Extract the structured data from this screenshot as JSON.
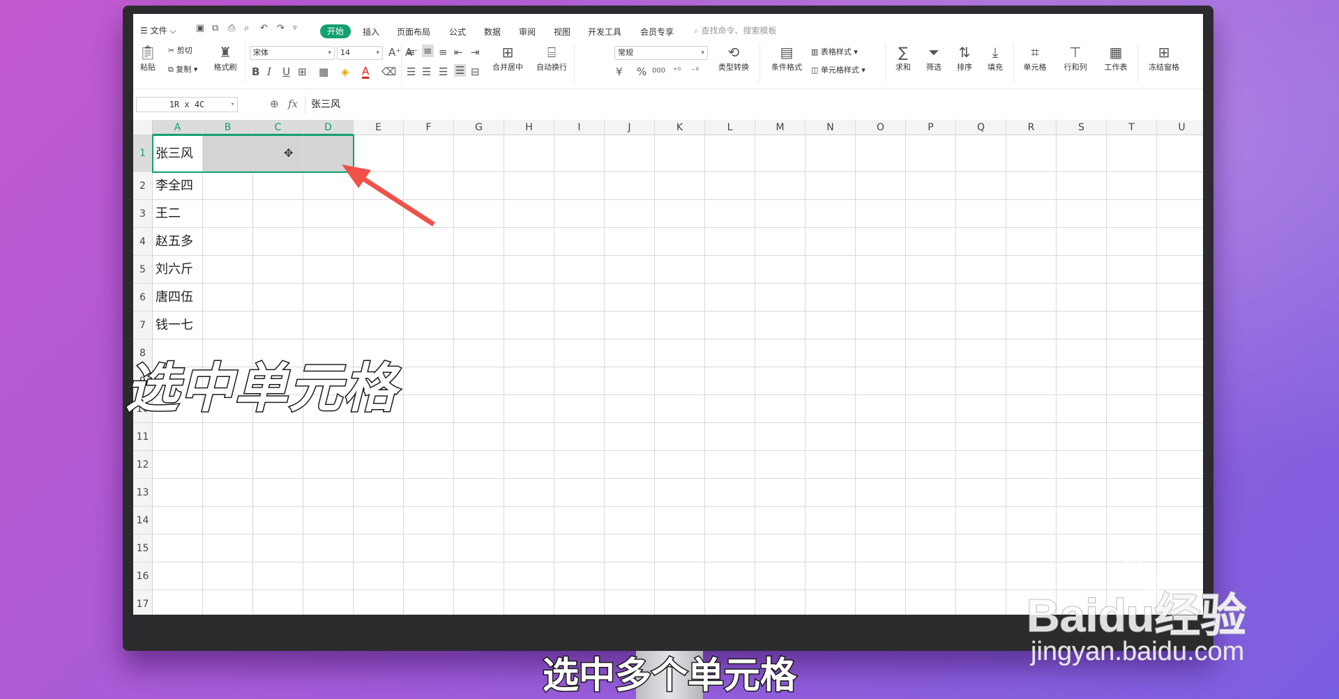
{
  "menubar": {
    "file_menu": "文件",
    "tabs": [
      "开始",
      "插入",
      "页面布局",
      "公式",
      "数据",
      "审阅",
      "视图",
      "开发工具",
      "会员专享"
    ],
    "active_tab": "开始",
    "search_hint": "查找命令、搜索模板"
  },
  "ribbon": {
    "paste": "粘贴",
    "cut": "剪切",
    "copy": "复制",
    "format_painter": "格式刷",
    "font_name": "宋体",
    "font_size": "14",
    "merge_center": "合并居中",
    "wrap_text": "自动换行",
    "number_format": "常规",
    "type_convert": "类型转换",
    "conditional_format": "条件格式",
    "table_style": "表格样式",
    "cell_style": "单元格样式",
    "sum": "求和",
    "filter": "筛选",
    "sort": "排序",
    "fill": "填充",
    "cell": "单元格",
    "row_col": "行和列",
    "worksheet": "工作表",
    "freeze": "冻结窗格",
    "bold": "B",
    "italic": "I",
    "underline": "U",
    "font_color_a": "A",
    "currency": "¥",
    "percent": "%",
    "thousands": "000"
  },
  "formula_bar": {
    "name_box": "1R x 4C",
    "fx": "fx",
    "content": "张三风"
  },
  "sheet": {
    "columns": [
      "A",
      "B",
      "C",
      "D",
      "E",
      "F",
      "G",
      "H",
      "I",
      "J",
      "K",
      "L",
      "M",
      "N",
      "O",
      "P",
      "Q",
      "R",
      "S",
      "T",
      "U"
    ],
    "rows": [
      "1",
      "2",
      "3",
      "4",
      "5",
      "6",
      "7",
      "8",
      "9",
      "10",
      "11",
      "12",
      "13",
      "14",
      "15",
      "16",
      "17"
    ],
    "col_a_values": [
      "张三风",
      "李全四",
      "王二",
      "赵五多",
      "刘六斤",
      "唐四伍",
      "钱一七",
      "",
      "",
      "",
      "",
      "",
      "",
      "",
      "",
      "",
      ""
    ]
  },
  "overlay": {
    "title": "选中单元格",
    "caption": "选中多个单元格"
  },
  "watermark": {
    "logo": "Baidu经验",
    "url": "jingyan.baidu.com"
  },
  "colors": {
    "accent": "#12a06e",
    "selection_shade": "#d4d4d4",
    "arrow": "#f0524a"
  }
}
